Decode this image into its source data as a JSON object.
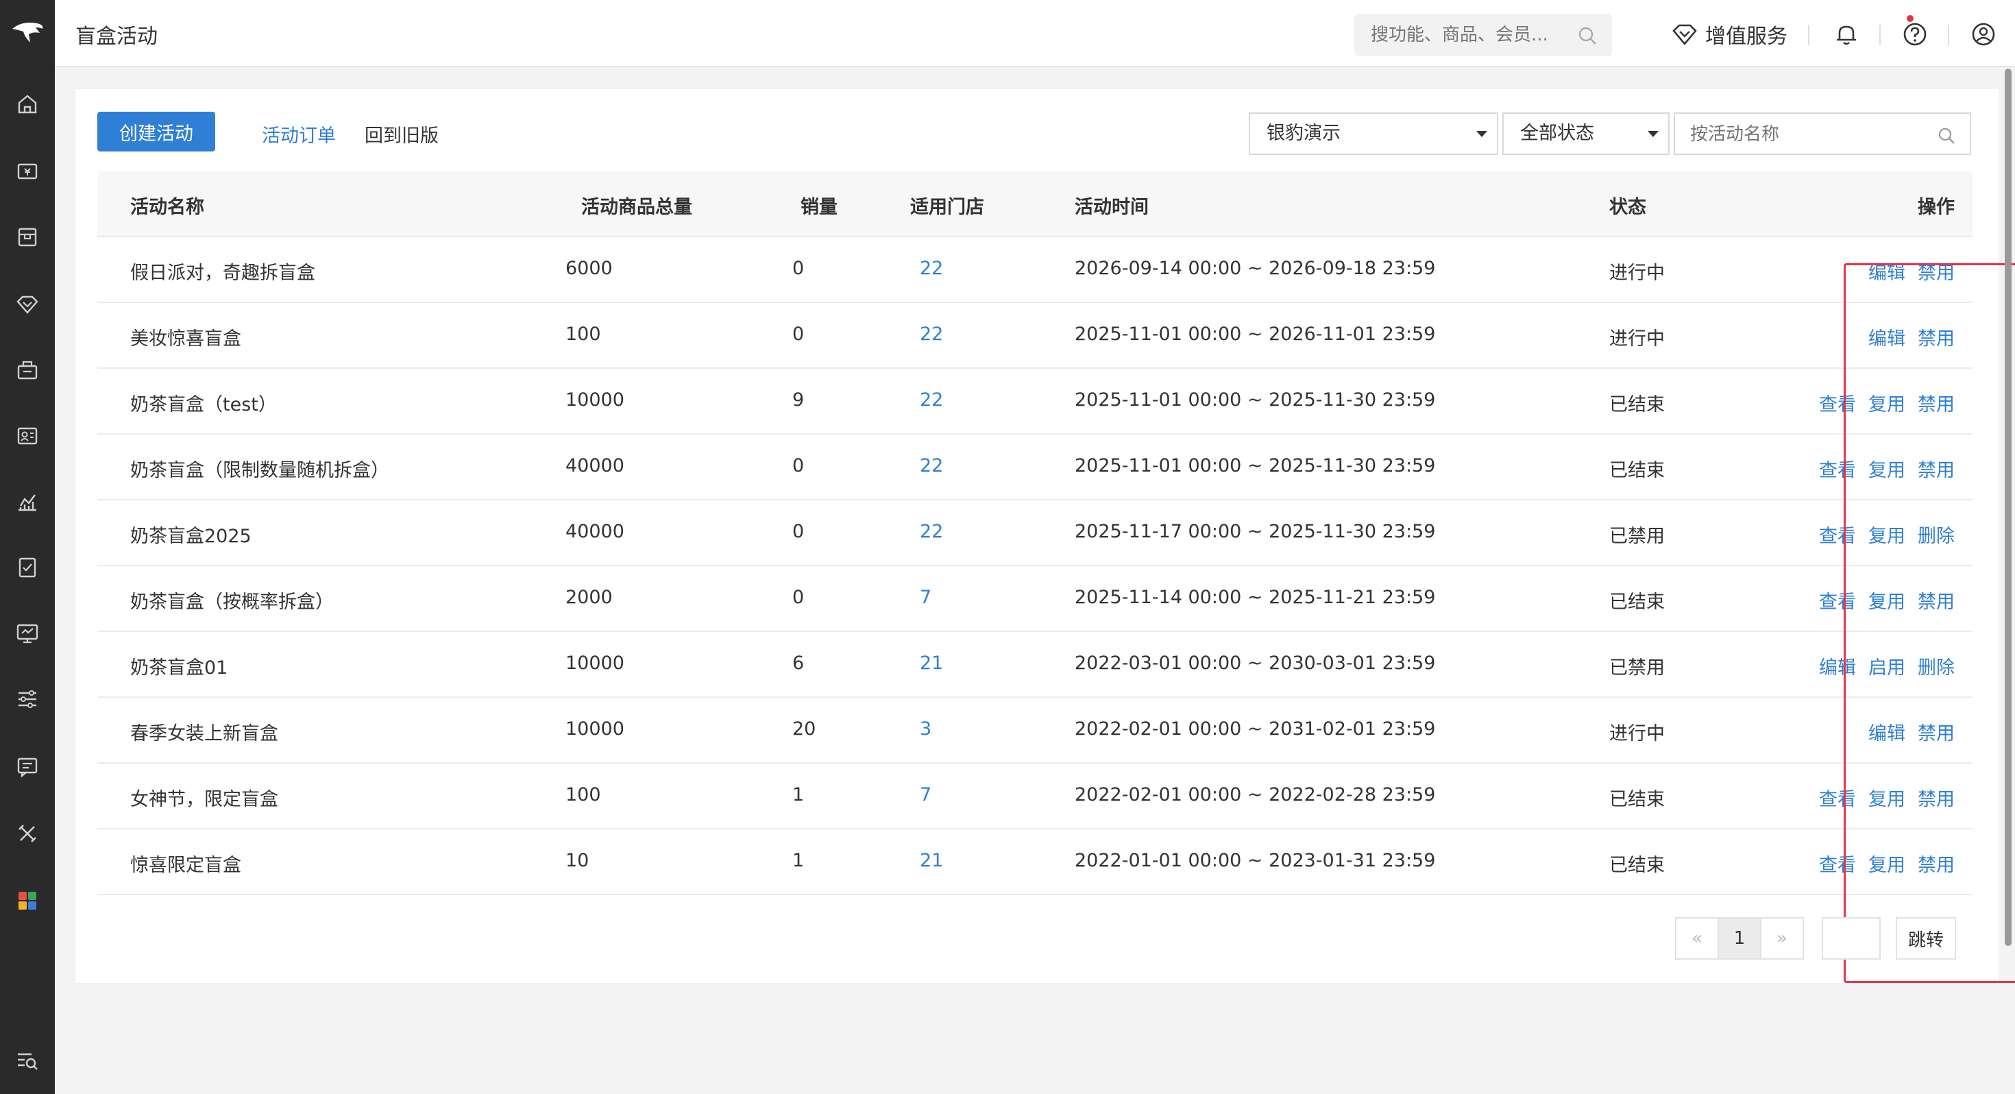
{
  "header": {
    "title": "盲盒活动",
    "search_placeholder": "搜功能、商品、会员...",
    "value_added_service": "增值服务"
  },
  "toolbar": {
    "create_label": "创建活动",
    "orders_label": "活动订单",
    "old_version_label": "回到旧版",
    "store_select": "银豹演示",
    "status_select": "全部状态",
    "name_placeholder": "按活动名称"
  },
  "table": {
    "columns": {
      "name": "活动名称",
      "total": "活动商品总量",
      "sales": "销量",
      "stores": "适用门店",
      "time": "活动时间",
      "status": "状态",
      "actions": "操作"
    },
    "rows": [
      {
        "name": "假日派对，奇趣拆盲盒",
        "total": "6000",
        "sales": "0",
        "stores": "22",
        "time": "2026-09-14 00:00 ~ 2026-09-18 23:59",
        "status": "进行中",
        "actions": [
          "编辑",
          "禁用"
        ]
      },
      {
        "name": "美妆惊喜盲盒",
        "total": "100",
        "sales": "0",
        "stores": "22",
        "time": "2025-11-01 00:00 ~ 2026-11-01 23:59",
        "status": "进行中",
        "actions": [
          "编辑",
          "禁用"
        ]
      },
      {
        "name": "奶茶盲盒（test）",
        "total": "10000",
        "sales": "9",
        "stores": "22",
        "time": "2025-11-01 00:00 ~ 2025-11-30 23:59",
        "status": "已结束",
        "actions": [
          "查看",
          "复用",
          "禁用"
        ]
      },
      {
        "name": "奶茶盲盒（限制数量随机拆盒）",
        "total": "40000",
        "sales": "0",
        "stores": "22",
        "time": "2025-11-01 00:00 ~ 2025-11-30 23:59",
        "status": "已结束",
        "actions": [
          "查看",
          "复用",
          "禁用"
        ]
      },
      {
        "name": "奶茶盲盒2025",
        "total": "40000",
        "sales": "0",
        "stores": "22",
        "time": "2025-11-17 00:00 ~ 2025-11-30 23:59",
        "status": "已禁用",
        "actions": [
          "查看",
          "复用",
          "删除"
        ]
      },
      {
        "name": "奶茶盲盒（按概率拆盒）",
        "total": "2000",
        "sales": "0",
        "stores": "7",
        "time": "2025-11-14 00:00 ~ 2025-11-21 23:59",
        "status": "已结束",
        "actions": [
          "查看",
          "复用",
          "禁用"
        ]
      },
      {
        "name": "奶茶盲盒01",
        "total": "10000",
        "sales": "6",
        "stores": "21",
        "time": "2022-03-01 00:00 ~ 2030-03-01 23:59",
        "status": "已禁用",
        "actions": [
          "编辑",
          "启用",
          "删除"
        ]
      },
      {
        "name": "春季女装上新盲盒",
        "total": "10000",
        "sales": "20",
        "stores": "3",
        "time": "2022-02-01 00:00 ~ 2031-02-01 23:59",
        "status": "进行中",
        "actions": [
          "编辑",
          "禁用"
        ]
      },
      {
        "name": "女神节，限定盲盒",
        "total": "100",
        "sales": "1",
        "stores": "7",
        "time": "2022-02-01 00:00 ~ 2022-02-28 23:59",
        "status": "已结束",
        "actions": [
          "查看",
          "复用",
          "禁用"
        ]
      },
      {
        "name": "惊喜限定盲盒",
        "total": "10",
        "sales": "1",
        "stores": "21",
        "time": "2022-01-01 00:00 ~ 2023-01-31 23:59",
        "status": "已结束",
        "actions": [
          "查看",
          "复用",
          "禁用"
        ]
      }
    ]
  },
  "pagination": {
    "prev": "«",
    "current": "1",
    "next": "»",
    "jump_label": "跳转"
  },
  "colors": {
    "accent": "#2f7fd6",
    "sidebar": "#2a2a2a",
    "highlight": "#e8334a"
  }
}
